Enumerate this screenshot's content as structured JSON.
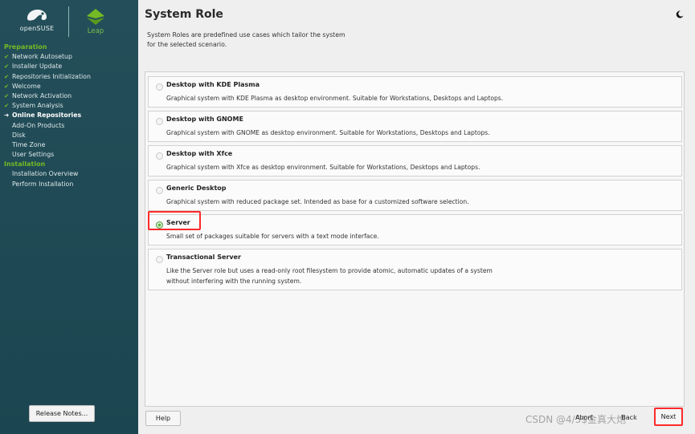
{
  "logo": {
    "opensuse": "openSUSE",
    "leap": "Leap"
  },
  "sidebar": {
    "sections": [
      {
        "title": "Preparation",
        "steps": [
          {
            "label": "Network Autosetup",
            "state": "done"
          },
          {
            "label": "Installer Update",
            "state": "done"
          },
          {
            "label": "Repositories Initialization",
            "state": "done"
          },
          {
            "label": "Welcome",
            "state": "done"
          },
          {
            "label": "Network Activation",
            "state": "done"
          },
          {
            "label": "System Analysis",
            "state": "done"
          },
          {
            "label": "Online Repositories",
            "state": "current"
          },
          {
            "label": "Add-On Products",
            "state": "pending"
          },
          {
            "label": "Disk",
            "state": "pending"
          },
          {
            "label": "Time Zone",
            "state": "pending"
          },
          {
            "label": "User Settings",
            "state": "pending"
          }
        ]
      },
      {
        "title": "Installation",
        "steps": [
          {
            "label": "Installation Overview",
            "state": "pending"
          },
          {
            "label": "Perform Installation",
            "state": "pending"
          }
        ]
      }
    ],
    "release_notes_label": "Release Notes..."
  },
  "page": {
    "title": "System Role",
    "intro_line1": "System Roles are predefined use cases which tailor the system",
    "intro_line2": "for the selected scenario."
  },
  "roles": [
    {
      "title": "Desktop with KDE Plasma",
      "desc": [
        "Graphical system with KDE Plasma as desktop environment. Suitable for Workstations, Desktops and Laptops."
      ],
      "selected": false
    },
    {
      "title": "Desktop with GNOME",
      "desc": [
        "Graphical system with GNOME as desktop environment. Suitable for Workstations, Desktops and Laptops."
      ],
      "selected": false
    },
    {
      "title": "Desktop with Xfce",
      "desc": [
        "Graphical system with Xfce as desktop environment. Suitable for Workstations, Desktops and Laptops."
      ],
      "selected": false
    },
    {
      "title": "Generic Desktop",
      "desc": [
        "Graphical system with reduced package set. Intended as base for a customized software selection."
      ],
      "selected": false
    },
    {
      "title": "Server",
      "desc": [
        "Small set of packages suitable for servers with a text mode interface."
      ],
      "selected": true
    },
    {
      "title": "Transactional Server",
      "desc": [
        "Like the Server role but uses a read-only root filesystem to provide atomic, automatic updates of a system",
        "without interfering with the running system."
      ],
      "selected": false
    }
  ],
  "buttons": {
    "help": "Help",
    "abort": "Abort",
    "back": "Back",
    "next": "Next"
  },
  "watermark": "CSDN @4/5$金真大炮",
  "colors": {
    "sidebar_bg": "#1f4a55",
    "accent_green": "#73ba25",
    "highlight_red": "#ff2a2a"
  },
  "icons": {
    "theme_toggle": "moon-icon",
    "done_mark": "checkmark-icon",
    "current_mark": "arrow-icon"
  }
}
